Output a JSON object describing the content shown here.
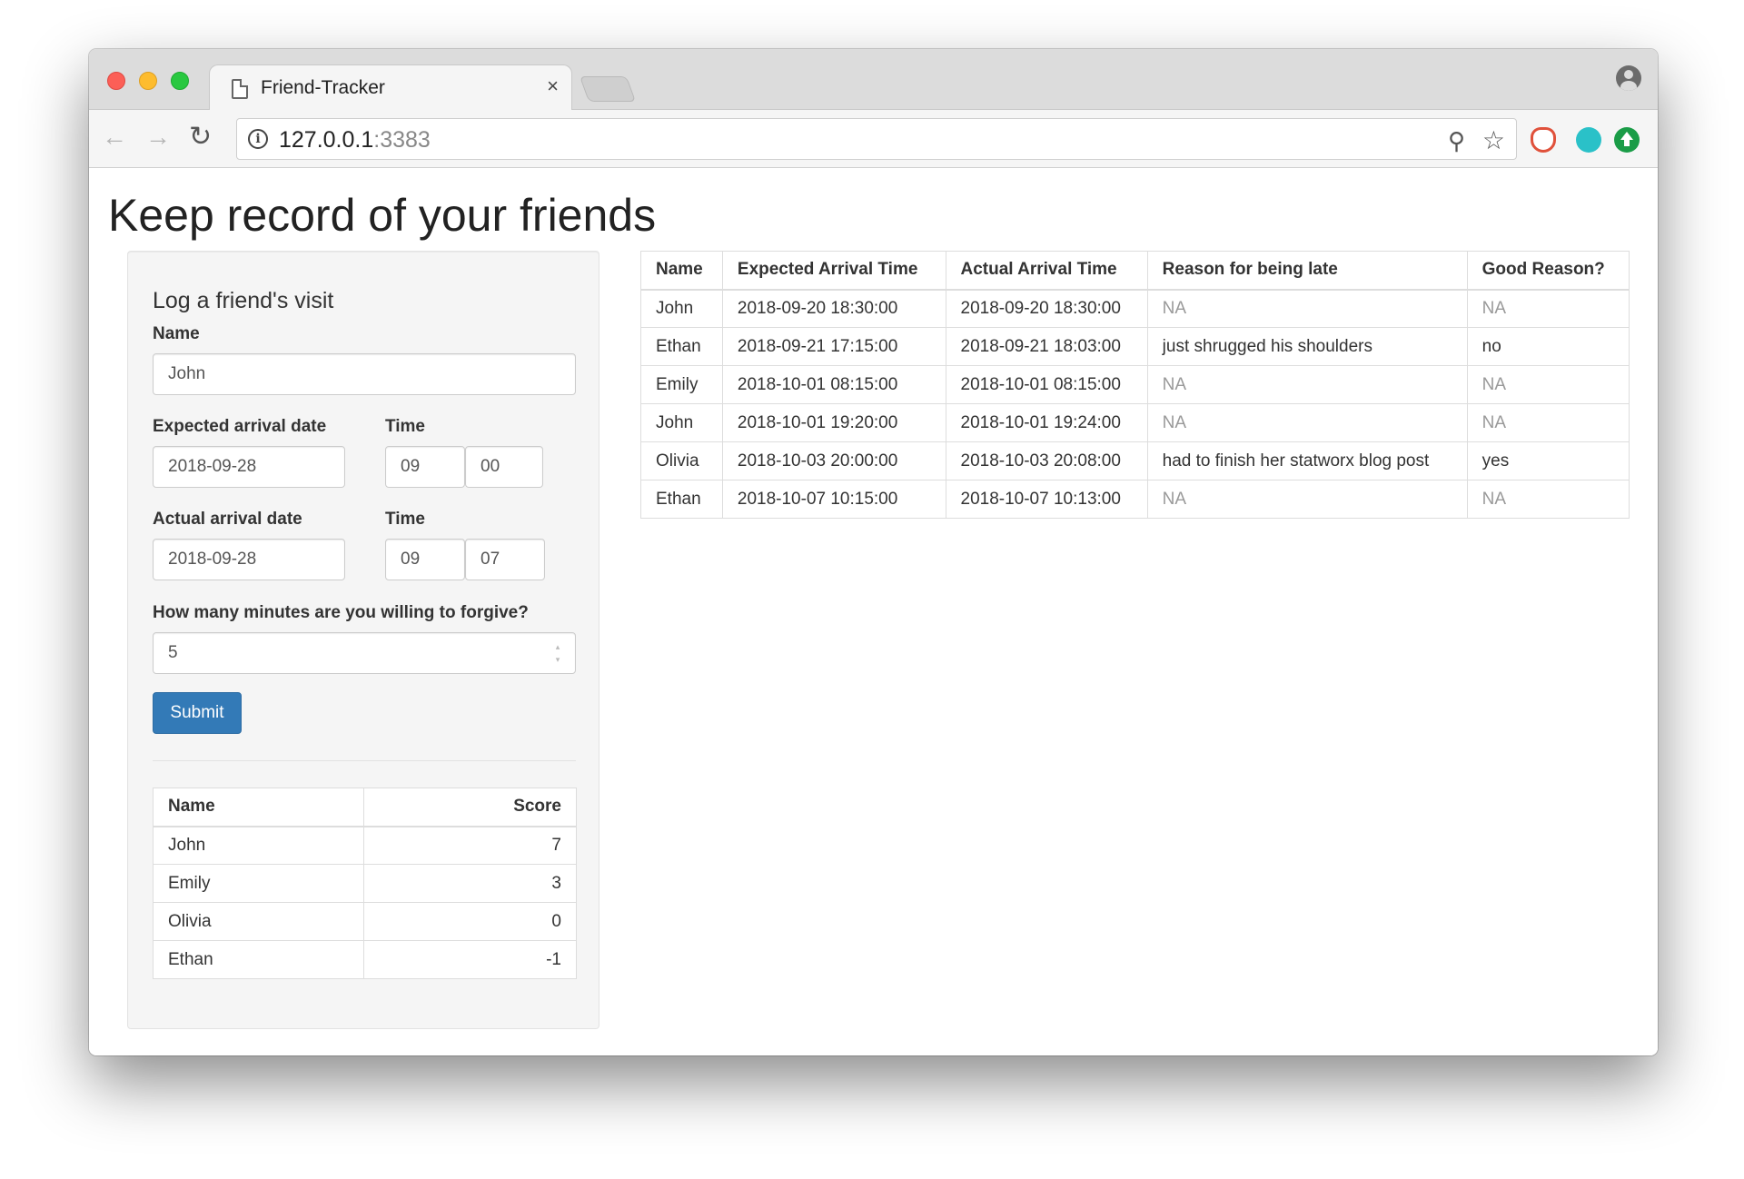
{
  "browser": {
    "tab_title": "Friend-Tracker",
    "tab_close": "×",
    "url_host": "127.0.0.1",
    "url_port": ":3383",
    "back_glyph": "←",
    "forward_glyph": "→",
    "reload_glyph": "↻",
    "info_glyph": "i",
    "zoom_glyph": "⚲",
    "star_glyph": "☆"
  },
  "page": {
    "title": "Keep record of your friends"
  },
  "form": {
    "heading": "Log a friend's visit",
    "name_label": "Name",
    "name_value": "John",
    "expected_date_label": "Expected arrival date",
    "expected_date_value": "2018-09-28",
    "expected_time_label": "Time",
    "expected_hour": "09",
    "expected_minute": "00",
    "actual_date_label": "Actual arrival date",
    "actual_date_value": "2018-09-28",
    "actual_time_label": "Time",
    "actual_hour": "09",
    "actual_minute": "07",
    "forgive_label": "How many minutes are you willing to forgive?",
    "forgive_value": "5",
    "submit_label": "Submit"
  },
  "scores": {
    "headers": [
      "Name",
      "Score"
    ],
    "rows": [
      [
        "John",
        "7"
      ],
      [
        "Emily",
        "3"
      ],
      [
        "Olivia",
        "0"
      ],
      [
        "Ethan",
        "-1"
      ]
    ]
  },
  "visits": {
    "headers": [
      "Name",
      "Expected Arrival Time",
      "Actual Arrival Time",
      "Reason for being late",
      "Good Reason?"
    ],
    "rows": [
      [
        "John",
        "2018-09-20 18:30:00",
        "2018-09-20 18:30:00",
        "NA",
        "NA"
      ],
      [
        "Ethan",
        "2018-09-21 17:15:00",
        "2018-09-21 18:03:00",
        "just shrugged his shoulders",
        "no"
      ],
      [
        "Emily",
        "2018-10-01 08:15:00",
        "2018-10-01 08:15:00",
        "NA",
        "NA"
      ],
      [
        "John",
        "2018-10-01 19:20:00",
        "2018-10-01 19:24:00",
        "NA",
        "NA"
      ],
      [
        "Olivia",
        "2018-10-03 20:00:00",
        "2018-10-03 20:08:00",
        "had to finish her statworx blog post",
        "yes"
      ],
      [
        "Ethan",
        "2018-10-07 10:15:00",
        "2018-10-07 10:13:00",
        "NA",
        "NA"
      ]
    ]
  },
  "colors": {
    "submit_bg": "#337ab7",
    "na_text": "#999999",
    "panel_bg": "#f5f5f5"
  }
}
